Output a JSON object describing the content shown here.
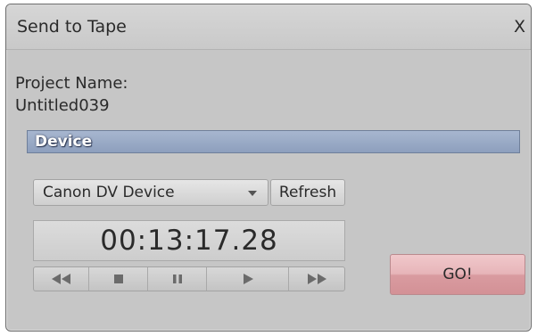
{
  "window": {
    "title": "Send to Tape",
    "close_label": "X"
  },
  "project": {
    "label": "Project Name:",
    "name": "Untitled039"
  },
  "device_section": {
    "header": "Device",
    "selected_device": "Canon DV Device",
    "refresh_label": "Refresh"
  },
  "timecode": "00:13:17.28",
  "transport": {
    "buttons": [
      "rewind-icon",
      "stop-icon",
      "pause-icon",
      "play-icon",
      "fast-forward-icon"
    ],
    "icon_color": "#6b6b6b"
  },
  "go_button": {
    "label": "GO!",
    "color": "#e7b5b9"
  },
  "colors": {
    "window_bg": "#c6c6c6",
    "section_bar": "#9aabc7"
  }
}
